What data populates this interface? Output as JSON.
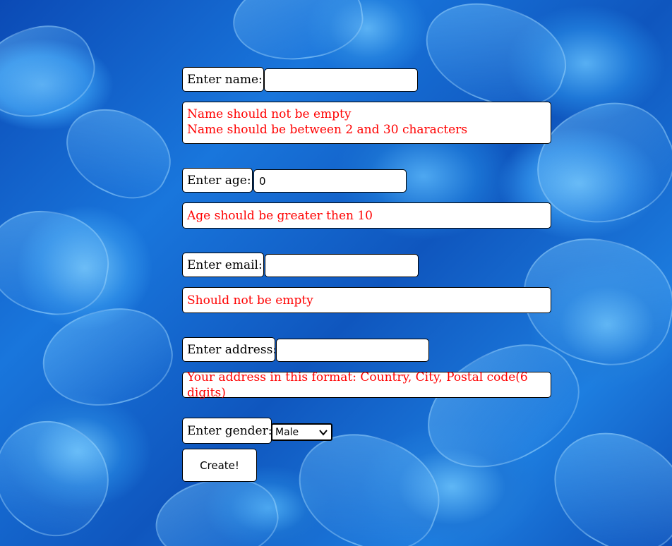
{
  "background": {
    "description_icon": "blue-flower-petals-background",
    "colors": [
      "#0b4ab5",
      "#1976dc",
      "#5fb4f5"
    ]
  },
  "form": {
    "name": {
      "label": "Enter name:",
      "value": "",
      "errors": [
        "Name should not be empty",
        "Name should be between 2 and 30 characters"
      ]
    },
    "age": {
      "label": "Enter age:",
      "value": "0",
      "errors": [
        "Age should be greater then 10"
      ]
    },
    "email": {
      "label": "Enter email:",
      "value": "",
      "errors": [
        "Should not be empty"
      ]
    },
    "address": {
      "label": "Enter address:",
      "value": "",
      "errors": [
        "Your address in this format: Country, City, Postal code(6 digits)"
      ]
    },
    "gender": {
      "label": "Enter gender:",
      "selected": "Male"
    },
    "submit_label": "Create!"
  },
  "colors": {
    "error_text": "#ff0000",
    "box_bg": "#ffffff",
    "border": "#000000"
  }
}
